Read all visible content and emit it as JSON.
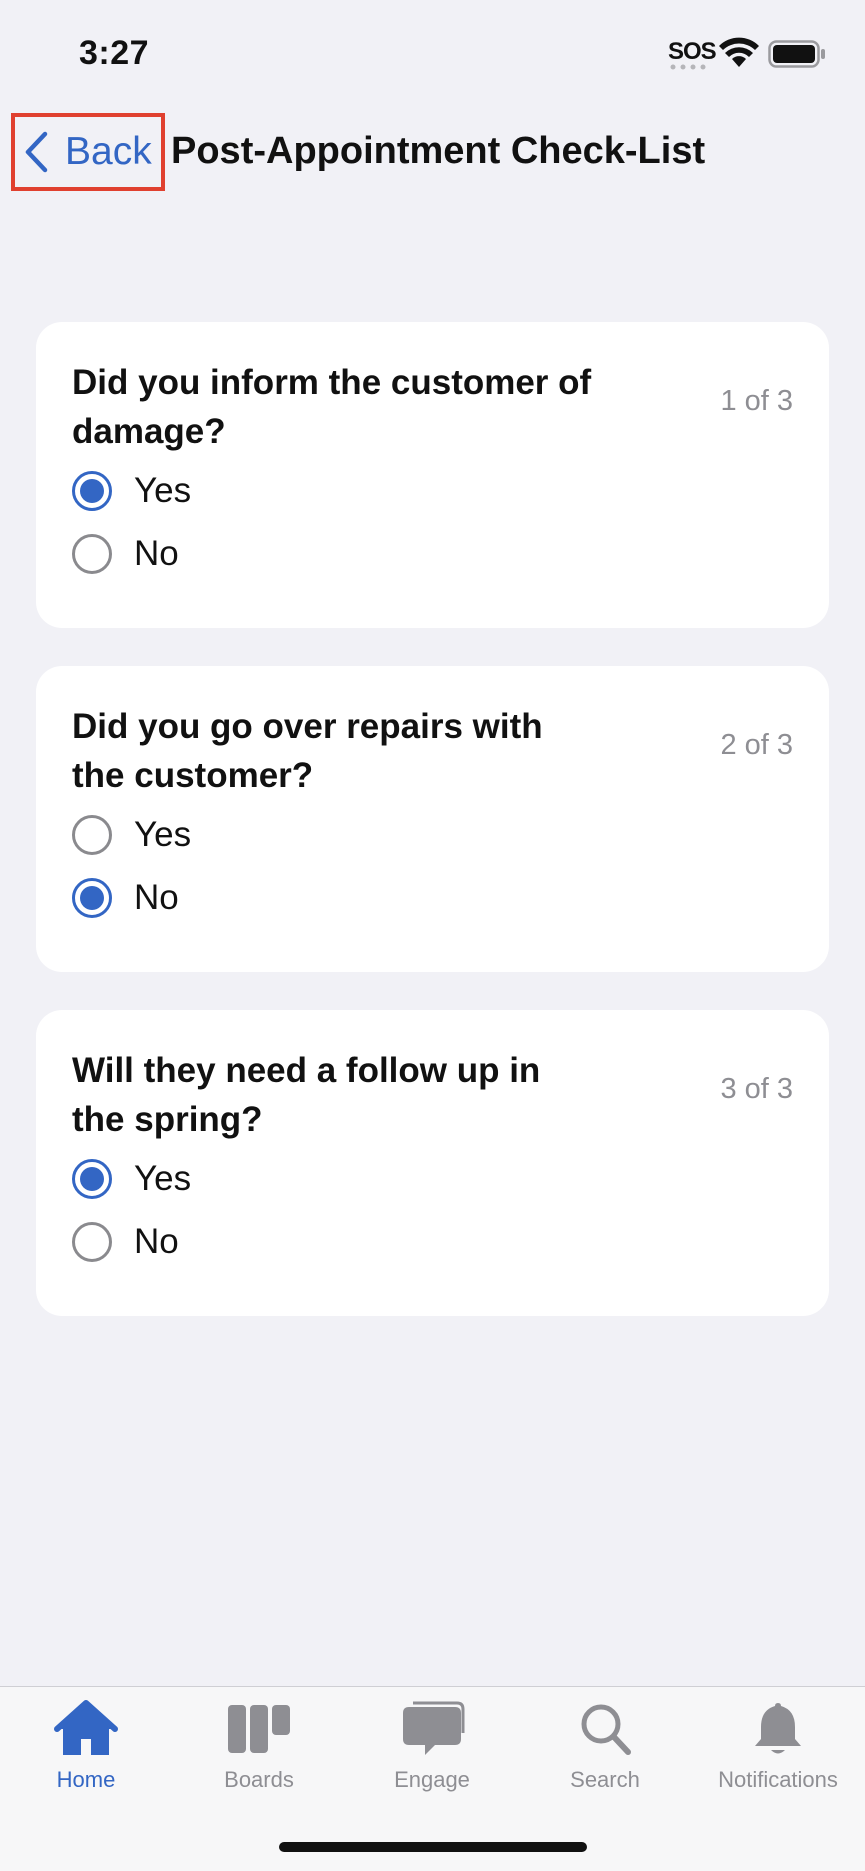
{
  "status_bar": {
    "time": "3:27",
    "sos": "SOS",
    "icons": [
      "wifi-icon",
      "battery-icon"
    ]
  },
  "nav": {
    "back_label": "Back",
    "back_icon": "chevron-left-icon",
    "title": "Post-Appointment Check-List"
  },
  "questions": [
    {
      "text": "Did you inform the customer of damage?",
      "counter": "1 of 3",
      "options": [
        {
          "label": "Yes",
          "selected": true
        },
        {
          "label": "No",
          "selected": false
        }
      ]
    },
    {
      "text": "Did you go over repairs with the customer?",
      "counter": "2 of 3",
      "options": [
        {
          "label": "Yes",
          "selected": false
        },
        {
          "label": "No",
          "selected": true
        }
      ]
    },
    {
      "text": "Will they need a follow up in the spring?",
      "counter": "3 of 3",
      "options": [
        {
          "label": "Yes",
          "selected": true
        },
        {
          "label": "No",
          "selected": false
        }
      ]
    }
  ],
  "tabs": [
    {
      "label": "Home",
      "icon": "home-icon",
      "active": true
    },
    {
      "label": "Boards",
      "icon": "boards-icon",
      "active": false
    },
    {
      "label": "Engage",
      "icon": "chat-bubble-icon",
      "active": false
    },
    {
      "label": "Search",
      "icon": "search-icon",
      "active": false
    },
    {
      "label": "Notifications",
      "icon": "bell-icon",
      "active": false
    }
  ],
  "colors": {
    "accent": "#3366c4",
    "background": "#f1f1f6",
    "highlight_border": "#e0402f",
    "inactive": "#8e8e93"
  }
}
